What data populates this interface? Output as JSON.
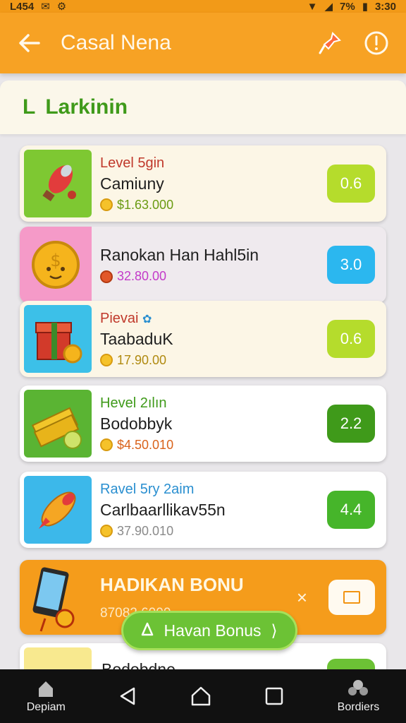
{
  "status_bar": {
    "carrier": "L454",
    "battery_pct": "7%",
    "time": "3:30"
  },
  "app_bar": {
    "title": "Casal Nena",
    "back_icon": "arrow-left-icon",
    "pin_icon": "pin-icon",
    "info_icon": "info-circle-icon"
  },
  "section": {
    "mark": "L",
    "title": "Larkinin"
  },
  "items": [
    {
      "level": "Level 5gin",
      "level_color": "#c0392b",
      "name": "Camiuny",
      "price": "$1.63.000",
      "price_color": "#6a9b12",
      "score": "0.6",
      "score_color": "#b5dc2c",
      "thumb_bg": "#7ec832",
      "icon": "rocket-icon"
    },
    {
      "level": "",
      "level_color": "#333333",
      "name": "Ranokan Han Hahl5in",
      "price": "32.80.00",
      "price_color": "#c33ac9",
      "score": "3.0",
      "score_color": "#2bb7ef",
      "thumb_bg": "#f59ac8",
      "icon": "coin-face-icon"
    },
    {
      "level": "Pievai",
      "level_color": "#c0392b",
      "name": "TaabaduK",
      "price": "17.90.00",
      "price_color": "#b08a10",
      "score": "0.6",
      "score_color": "#b5dc2c",
      "thumb_bg": "#3cc0e8",
      "icon": "gift-box-icon"
    },
    {
      "level": "Hevel 2ılın",
      "level_color": "#3f9a1a",
      "name": "Bodobbyk",
      "price": "$4.50.010",
      "price_color": "#d9621a",
      "score": "2.2",
      "score_color": "#3f9a1a",
      "thumb_bg": "#5ab433",
      "icon": "cash-stack-icon"
    },
    {
      "level": "Ravel 5ry 2aim",
      "level_color": "#2a8fd0",
      "name": "Carlbaarllikav55n",
      "price": "37.90.010",
      "price_color": "#8a8a8a",
      "score": "4.4",
      "score_color": "#46b52a",
      "thumb_bg": "#3cb8ea",
      "icon": "rocket-icon"
    }
  ],
  "bonus": {
    "title": "HADIKAN BONU",
    "subtitle": "87082 6000",
    "close": "×"
  },
  "fab": {
    "label": "Havan Bonus",
    "arrow": "⟩"
  },
  "partial_item": {
    "name": "Bodobdne"
  },
  "nav": {
    "left_label": "Depiam",
    "right_label": "Bordiers"
  }
}
